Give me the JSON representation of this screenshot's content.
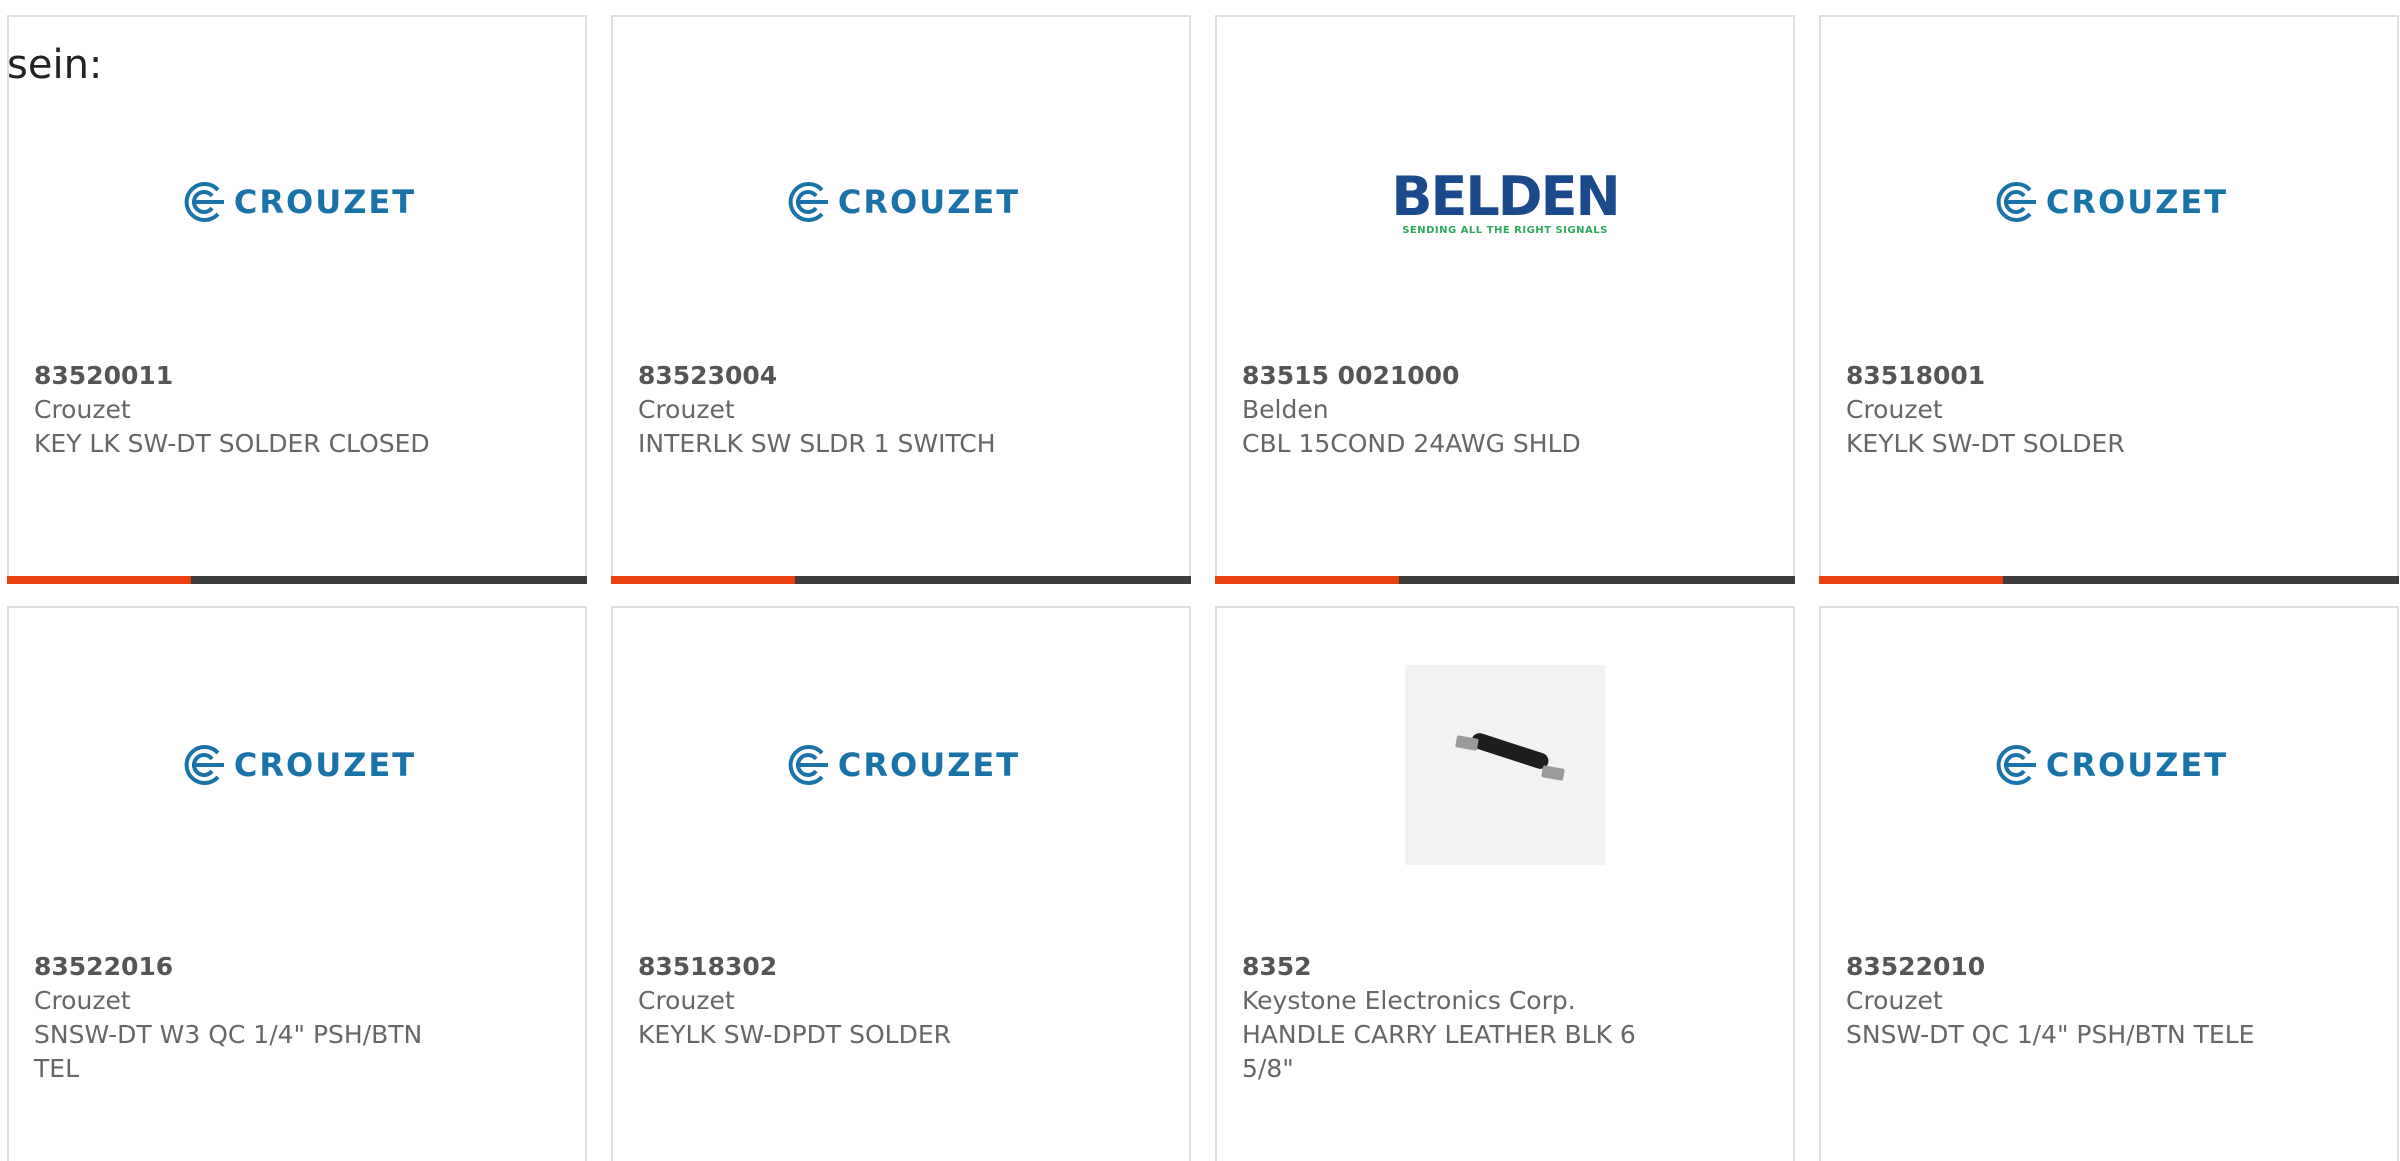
{
  "intro_text": "sein:",
  "colors": {
    "accent": "#e8400f",
    "bar": "#3d3d3d",
    "crouzet_blue": "#1a73a8",
    "belden_blue": "#1a4a8c",
    "belden_green": "#2fa85a"
  },
  "products": [
    {
      "part_number": "83520011",
      "manufacturer": "Crouzet",
      "description": "KEY LK SW-DT SOLDER CLOSED",
      "logo": "crouzet-logo"
    },
    {
      "part_number": "83523004",
      "manufacturer": "Crouzet",
      "description": "INTERLK SW SLDR 1 SWITCH",
      "logo": "crouzet-logo"
    },
    {
      "part_number": "83515 0021000",
      "manufacturer": "Belden",
      "description": "CBL 15COND 24AWG SHLD",
      "logo": "belden-logo"
    },
    {
      "part_number": "83518001",
      "manufacturer": "Crouzet",
      "description": "KEYLK SW-DT SOLDER",
      "logo": "crouzet-logo"
    },
    {
      "part_number": "83522016",
      "manufacturer": "Crouzet",
      "description": "SNSW-DT W3 QC 1/4\" PSH/BTN TEL",
      "logo": "crouzet-logo"
    },
    {
      "part_number": "83518302",
      "manufacturer": "Crouzet",
      "description": "KEYLK SW-DPDT SOLDER",
      "logo": "crouzet-logo"
    },
    {
      "part_number": "8352",
      "manufacturer": "Keystone Electronics Corp.",
      "description": "HANDLE CARRY LEATHER BLK 6 5/8\"",
      "logo": "handle-photo"
    },
    {
      "part_number": "83522010",
      "manufacturer": "Crouzet",
      "description": "SNSW-DT QC 1/4\" PSH/BTN TELE",
      "logo": "crouzet-logo"
    }
  ],
  "logos": {
    "crouzet": "CROUZET",
    "belden": "BELDEN",
    "belden_tagline": "SENDING ALL THE RIGHT SIGNALS"
  }
}
